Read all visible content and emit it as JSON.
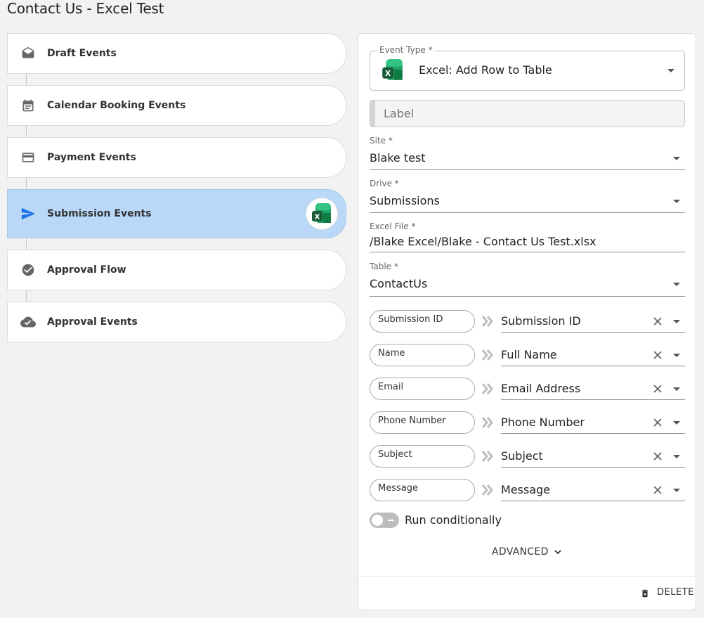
{
  "page": {
    "title": "Contact Us - Excel Test"
  },
  "steps": [
    {
      "label": "Draft Events",
      "icon": "drafts-icon"
    },
    {
      "label": "Calendar Booking Events",
      "icon": "calendar-icon"
    },
    {
      "label": "Payment Events",
      "icon": "credit-card-icon"
    },
    {
      "label": "Submission Events",
      "icon": "send-icon",
      "active": true,
      "badge_icon": "excel-icon"
    },
    {
      "label": "Approval Flow",
      "icon": "check-circle-icon"
    },
    {
      "label": "Approval Events",
      "icon": "cloud-done-icon"
    }
  ],
  "form": {
    "event_type": {
      "label": "Event Type *",
      "value": "Excel: Add Row to Table",
      "icon": "excel-icon"
    },
    "label_field": {
      "placeholder": "Label"
    },
    "site": {
      "label": "Site *",
      "value": "Blake test"
    },
    "drive": {
      "label": "Drive *",
      "value": "Submissions"
    },
    "excel_file": {
      "label": "Excel File *",
      "value": "/Blake Excel/Blake - Contact Us Test.xlsx"
    },
    "table": {
      "label": "Table *",
      "value": "ContactUs"
    },
    "mappings": [
      {
        "source": "Submission ID",
        "target": "Submission ID"
      },
      {
        "source": "Name",
        "target": "Full Name"
      },
      {
        "source": "Email",
        "target": "Email Address"
      },
      {
        "source": "Phone Number",
        "target": "Phone Number"
      },
      {
        "source": "Subject",
        "target": "Subject"
      },
      {
        "source": "Message",
        "target": "Message"
      }
    ],
    "run_conditionally": {
      "label": "Run conditionally",
      "enabled": false
    },
    "advanced_label": "ADVANCED",
    "delete_label": "DELETE"
  },
  "colors": {
    "active_step": "#b9d8f7",
    "send_icon": "#1a73e8",
    "excel_green": "#1e8e3e"
  }
}
